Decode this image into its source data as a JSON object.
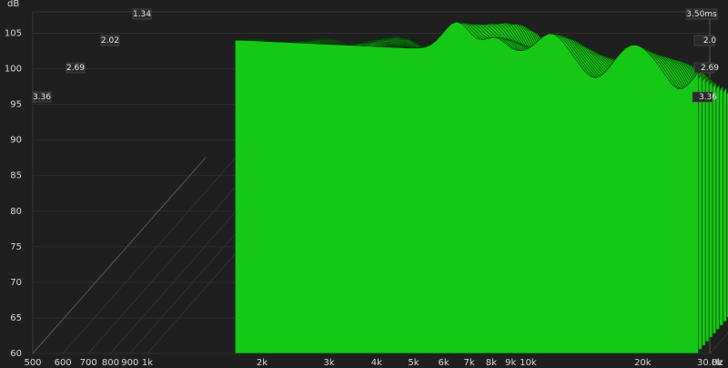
{
  "chart_data": {
    "type": "area",
    "title": "",
    "y_unit": "dB",
    "x_unit": "Hz",
    "ylim": [
      60,
      108
    ],
    "xlim": [
      500,
      30000
    ],
    "x_scale": "log",
    "y_ticks": [
      60,
      65,
      70,
      75,
      80,
      85,
      90,
      95,
      100,
      105
    ],
    "x_ticks": [
      {
        "v": 500,
        "label": "500"
      },
      {
        "v": 600,
        "label": "600"
      },
      {
        "v": 700,
        "label": "700"
      },
      {
        "v": 800,
        "label": "800"
      },
      {
        "v": 900,
        "label": "900"
      },
      {
        "v": 1000,
        "label": "1k"
      },
      {
        "v": 2000,
        "label": "2k"
      },
      {
        "v": 3000,
        "label": "3k"
      },
      {
        "v": 4000,
        "label": "4k"
      },
      {
        "v": 5000,
        "label": "5k"
      },
      {
        "v": 6000,
        "label": "6k"
      },
      {
        "v": 7000,
        "label": "7k"
      },
      {
        "v": 8000,
        "label": "8k"
      },
      {
        "v": 9000,
        "label": "9k"
      },
      {
        "v": 10000,
        "label": "10k"
      },
      {
        "v": 20000,
        "label": "20k"
      },
      {
        "v": 30000,
        "label": "30.0k"
      }
    ],
    "time_labels_left": [
      "1.34",
      "2.02",
      "2.69",
      "3.36"
    ],
    "time_labels_right": [
      "3.50ms",
      "2.0",
      "2.69",
      "3.36"
    ],
    "slices": 50,
    "time_range_ms": [
      0,
      3.5
    ],
    "grid": true,
    "fill_color": "#16c816",
    "line_color": "#0a3a0a",
    "series_envelope": [
      {
        "f": 1800,
        "db": 105.5
      },
      {
        "f": 3000,
        "db": 104
      },
      {
        "f": 4200,
        "db": 99
      },
      {
        "f": 6500,
        "db": 106
      },
      {
        "f": 8500,
        "db": 104
      },
      {
        "f": 12000,
        "db": 106
      },
      {
        "f": 17000,
        "db": 103
      },
      {
        "f": 30000,
        "db": 93
      }
    ]
  }
}
